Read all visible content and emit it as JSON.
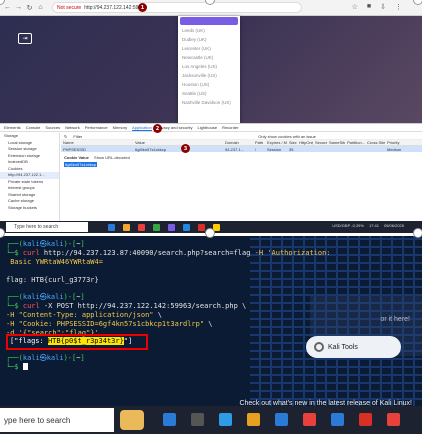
{
  "browser": {
    "url_warning": "Not secure",
    "url": "http://94.237.122.142:59963",
    "badge1": "1",
    "nav_icons": [
      "back-icon",
      "forward-icon",
      "reload-icon",
      "home-icon"
    ],
    "dropdown": {
      "options": [
        "Leeds (UK)",
        "Dudley (UK)",
        "Leicester (UK)",
        "Newcastle (UK)",
        "Los Angeles (US)",
        "Jacksonville (US)",
        "Houston (US)",
        "Seattle (US)",
        "Nashville Davidson (US)"
      ]
    },
    "devtools": {
      "tabs": [
        "Elements",
        "Console",
        "Sources",
        "Network",
        "Performance",
        "Memory",
        "Application",
        "Privacy and security",
        "Lighthouse",
        "Recorder"
      ],
      "active_tab": "Application",
      "badge2": "2",
      "sidebar": [
        "Storage",
        "Local storage",
        "Session storage",
        "Extension storage",
        "IndexedDB",
        "Cookies",
        "http://94.237.122.1...",
        "Private state tokens",
        "Interest groups",
        "Shared storage",
        "Cache storage",
        "Storage buckets"
      ],
      "filter_placeholder": "Filter",
      "only_issues": "Only show cookies with an issue",
      "columns": [
        "Name",
        "Value",
        "Domain",
        "Path",
        "Expires / Ma...",
        "Size",
        "HttpOnly",
        "Secure",
        "SameSite",
        "Partition...",
        "Cross Site",
        "Priority"
      ],
      "cookie_row": [
        "PHPSESSID",
        "6gf4kn57s1cbkcp",
        "94.237.1...",
        "/",
        "Session",
        "35",
        "",
        "",
        "",
        "",
        "",
        "Medium"
      ],
      "badge3": "3",
      "cookie_value_label": "Cookie Value",
      "show_url_decoded": "Show URL-decoded",
      "cookie_value": "6gf4kn57s1cbkcp"
    },
    "taskbar": {
      "search": "Type here to search",
      "tray_text": "USD/GBP -0.29%",
      "time": "17:41",
      "date": "05/06/2025",
      "colors": [
        "#2b7ad6",
        "#f0a830",
        "#e8403a",
        "#38a545",
        "#7b5de5",
        "#1e8ae0",
        "#d93025",
        "#ffcc00"
      ]
    }
  },
  "terminal": {
    "lines": [
      {
        "parts": [
          {
            "c": "prompt-g",
            "t": "┌──("
          },
          {
            "c": "prompt-b",
            "t": "kali㉿kali"
          },
          {
            "c": "prompt-g",
            "t": ")-["
          },
          {
            "c": "plain",
            "t": "~"
          },
          {
            "c": "prompt-g",
            "t": "]"
          }
        ]
      },
      {
        "parts": [
          {
            "c": "prompt-g",
            "t": "└─$ "
          },
          {
            "c": "cmd-r",
            "t": "curl"
          },
          {
            "c": "plain",
            "t": " http://94.237.123.87:40090/search.php?search=flag "
          },
          {
            "c": "str-y",
            "t": "-H 'Authorization:"
          }
        ]
      },
      {
        "parts": [
          {
            "c": "str-y",
            "t": " Basic YWRtaW46YWRtaW4="
          }
        ]
      },
      {
        "parts": [
          {
            "c": "plain",
            "t": ""
          }
        ]
      },
      {
        "parts": [
          {
            "c": "plain",
            "t": "flag: HTB{curl_g3773r}"
          }
        ]
      },
      {
        "parts": [
          {
            "c": "plain",
            "t": ""
          }
        ]
      },
      {
        "parts": [
          {
            "c": "prompt-g",
            "t": "┌──("
          },
          {
            "c": "prompt-b",
            "t": "kali㉿kali"
          },
          {
            "c": "prompt-g",
            "t": ")-["
          },
          {
            "c": "plain",
            "t": "~"
          },
          {
            "c": "prompt-g",
            "t": "]"
          }
        ]
      },
      {
        "parts": [
          {
            "c": "prompt-g",
            "t": "└─$ "
          },
          {
            "c": "cmd-r",
            "t": "curl"
          },
          {
            "c": "plain",
            "t": " -X POST http://94.237.122.142:59963/search.php \\"
          }
        ]
      },
      {
        "parts": [
          {
            "c": "str-y",
            "t": "-H \"Content-Type: application/json\""
          },
          {
            "c": "plain",
            "t": " \\"
          }
        ]
      },
      {
        "parts": [
          {
            "c": "str-y",
            "t": "-H \"Cookie: PHPSESSID=6gf4kn57s1cbkcp1t3ardlrp\""
          },
          {
            "c": "plain",
            "t": " \\"
          }
        ]
      },
      {
        "parts": [
          {
            "c": "str-y",
            "t": "-d '{\"search\":\"flag\"}'"
          }
        ]
      }
    ],
    "flag_prefix": "[\"flags: ",
    "flag_value": "HTB{p0$t_r3p34t3r}",
    "flag_suffix": "\"]",
    "after_lines": [
      {
        "parts": [
          {
            "c": "prompt-g",
            "t": "┌──("
          },
          {
            "c": "prompt-b",
            "t": "kali㉿kali"
          },
          {
            "c": "prompt-g",
            "t": ")-["
          },
          {
            "c": "plain",
            "t": "~"
          },
          {
            "c": "prompt-g",
            "t": "]"
          }
        ]
      },
      {
        "parts": [
          {
            "c": "prompt-g",
            "t": "└─$ "
          }
        ]
      }
    ],
    "desktop_help": "or it here!",
    "kali_tools": "Kali Tools",
    "whatsnew": "Check out what's new in the latest release of Kali Linux!",
    "taskbar_search": "ype here to search",
    "taskbar_colors": [
      "#2b7ad6",
      "#555",
      "#2e9be6",
      "#e8a020",
      "#2b7ad6",
      "#e8403a",
      "#2b7ad6",
      "#d93025",
      "#e8403a"
    ]
  }
}
